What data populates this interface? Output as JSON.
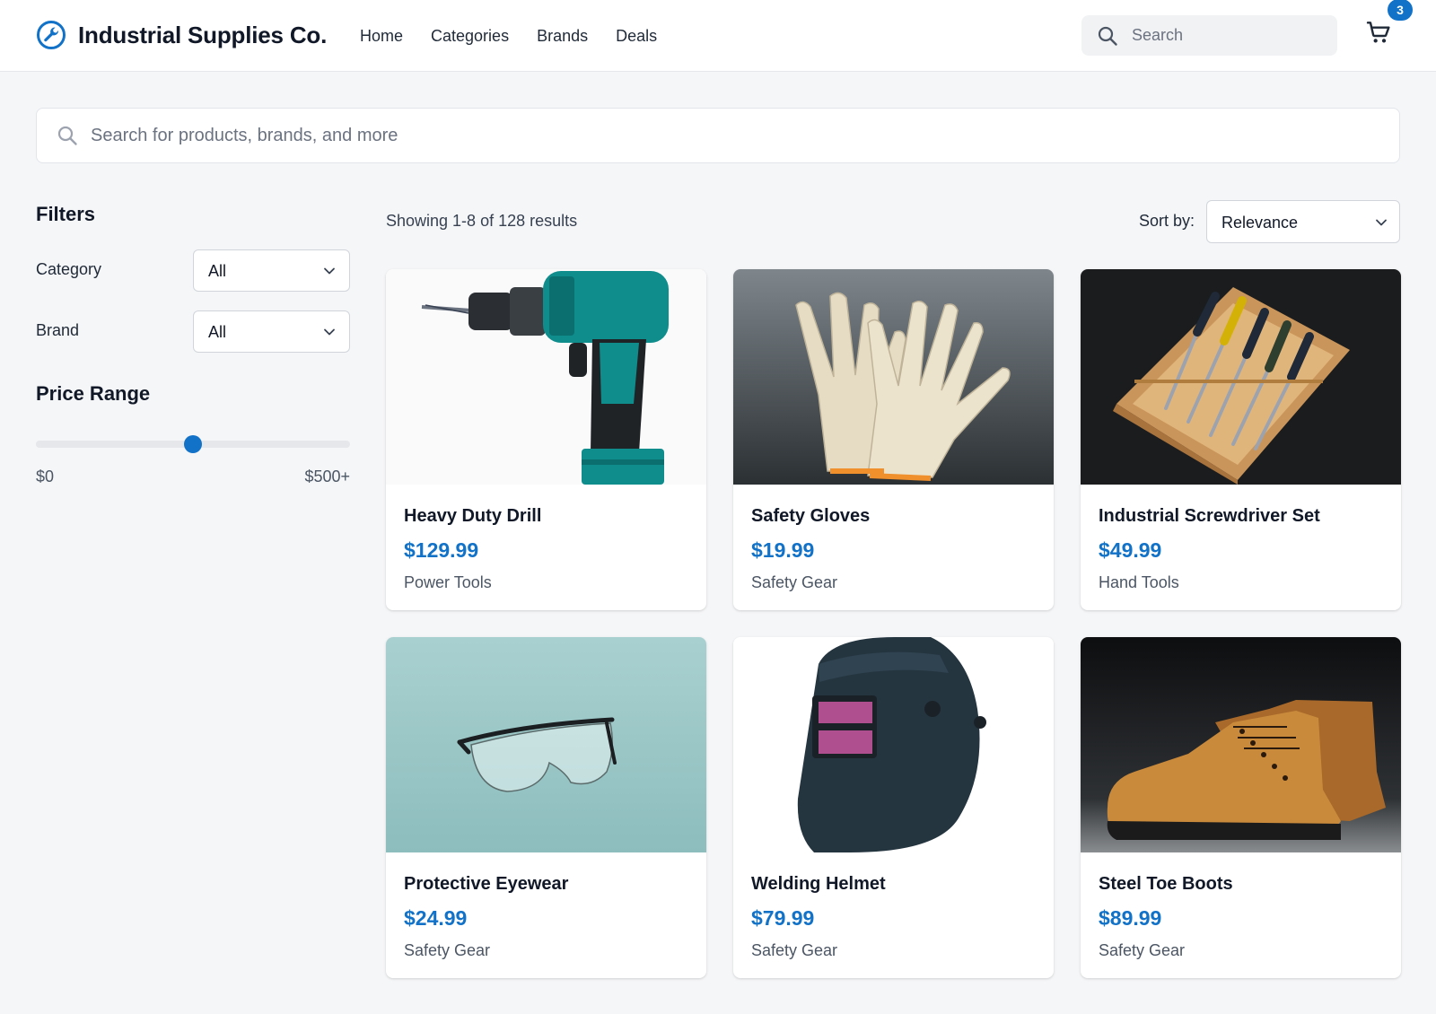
{
  "header": {
    "brand_name": "Industrial Supplies Co.",
    "nav": [
      "Home",
      "Categories",
      "Brands",
      "Deals"
    ],
    "search_placeholder": "Search",
    "cart_count": "3",
    "accent_color": "#1272c8"
  },
  "main_search": {
    "placeholder": "Search for products, brands, and more"
  },
  "filters": {
    "title": "Filters",
    "category_label": "Category",
    "category_value": "All",
    "brand_label": "Brand",
    "brand_value": "All",
    "price_title": "Price Range",
    "price_min_label": "$0",
    "price_max_label": "$500+",
    "price_slider_fraction": 0.5
  },
  "results": {
    "count_text": "Showing 1-8 of 128 results",
    "sort_label": "Sort by:",
    "sort_value": "Relevance"
  },
  "products": [
    {
      "name": "Heavy Duty Drill",
      "price": "$129.99",
      "category": "Power Tools",
      "image_icon": "drill-image"
    },
    {
      "name": "Safety Gloves",
      "price": "$19.99",
      "category": "Safety Gear",
      "image_icon": "gloves-image"
    },
    {
      "name": "Industrial Screwdriver Set",
      "price": "$49.99",
      "category": "Hand Tools",
      "image_icon": "screwdriver-set-image"
    },
    {
      "name": "Protective Eyewear",
      "price": "$24.99",
      "category": "Safety Gear",
      "image_icon": "eyewear-image"
    },
    {
      "name": "Welding Helmet",
      "price": "$79.99",
      "category": "Safety Gear",
      "image_icon": "welding-helmet-image"
    },
    {
      "name": "Steel Toe Boots",
      "price": "$89.99",
      "category": "Safety Gear",
      "image_icon": "boots-image"
    }
  ]
}
